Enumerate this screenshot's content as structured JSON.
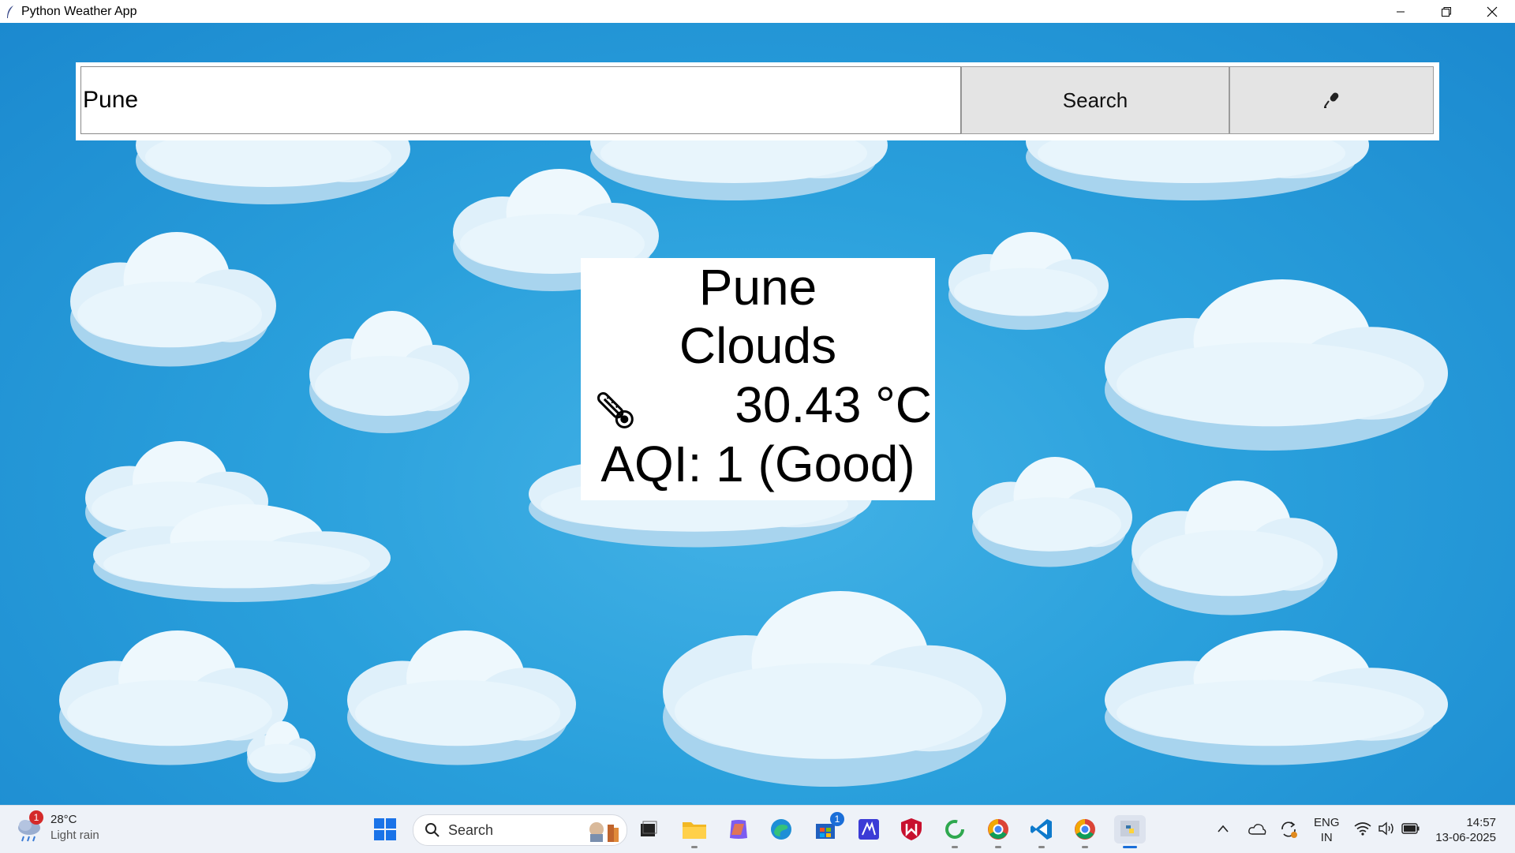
{
  "window": {
    "title": "Python Weather App"
  },
  "search": {
    "value": "Pune",
    "button_label": "Search",
    "mic_icon": "microphone-icon"
  },
  "result": {
    "city": "Pune",
    "condition": "Clouds",
    "temperature": "30.43 °C",
    "aqi": "AQI: 1 (Good)",
    "thermometer_icon": "thermometer-icon"
  },
  "taskbar": {
    "weather": {
      "temp": "28°C",
      "condition": "Light rain",
      "badge": "1"
    },
    "search_label": "Search",
    "store_badge": "1",
    "lang_line1": "ENG",
    "lang_line2": "IN",
    "time": "14:57",
    "date": "13-06-2025"
  },
  "colors": {
    "sky": "#1e90d6",
    "cloud": "#dff0fa",
    "cloud_shadow": "#a8d4ee",
    "taskbar": "#eef2f8"
  }
}
